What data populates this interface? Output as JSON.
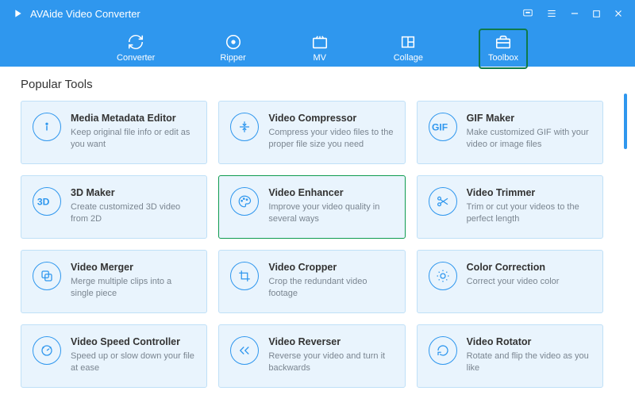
{
  "app": {
    "title": "AVAide Video Converter"
  },
  "nav": {
    "items": [
      {
        "label": "Converter",
        "id": "converter"
      },
      {
        "label": "Ripper",
        "id": "ripper"
      },
      {
        "label": "MV",
        "id": "mv"
      },
      {
        "label": "Collage",
        "id": "collage"
      },
      {
        "label": "Toolbox",
        "id": "toolbox"
      }
    ],
    "active": "toolbox"
  },
  "section": {
    "title": "Popular Tools"
  },
  "tools": [
    {
      "title": "Media Metadata Editor",
      "desc": "Keep original file info or edit as you want",
      "icon": "info"
    },
    {
      "title": "Video Compressor",
      "desc": "Compress your video files to the proper file size you need",
      "icon": "compress"
    },
    {
      "title": "GIF Maker",
      "desc": "Make customized GIF with your video or image files",
      "icon": "gif"
    },
    {
      "title": "3D Maker",
      "desc": "Create customized 3D video from 2D",
      "icon": "3d"
    },
    {
      "title": "Video Enhancer",
      "desc": "Improve your video quality in several ways",
      "icon": "palette",
      "highlight": true
    },
    {
      "title": "Video Trimmer",
      "desc": "Trim or cut your videos to the perfect length",
      "icon": "scissors"
    },
    {
      "title": "Video Merger",
      "desc": "Merge multiple clips into a single piece",
      "icon": "merge"
    },
    {
      "title": "Video Cropper",
      "desc": "Crop the redundant video footage",
      "icon": "crop"
    },
    {
      "title": "Color Correction",
      "desc": "Correct your video color",
      "icon": "brightness"
    },
    {
      "title": "Video Speed Controller",
      "desc": "Speed up or slow down your file at ease",
      "icon": "speed"
    },
    {
      "title": "Video Reverser",
      "desc": "Reverse your video and turn it backwards",
      "icon": "reverse"
    },
    {
      "title": "Video Rotator",
      "desc": "Rotate and flip the video as you like",
      "icon": "rotate"
    }
  ]
}
